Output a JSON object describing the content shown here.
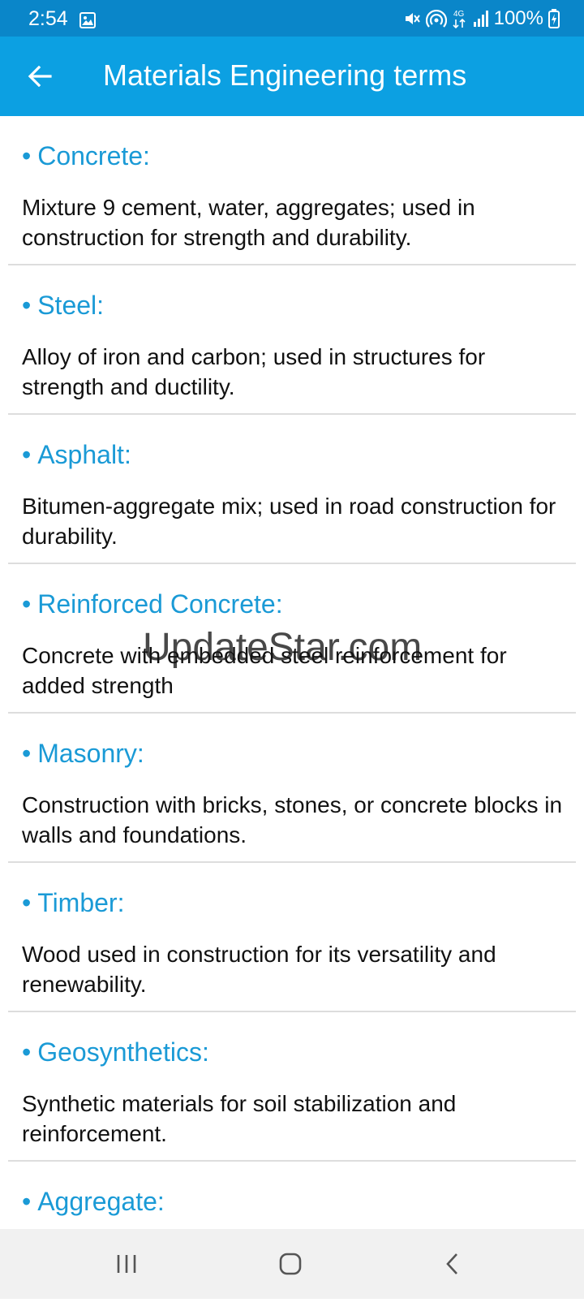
{
  "status_bar": {
    "time": "2:54",
    "network": "4G",
    "battery": "100%"
  },
  "app_bar": {
    "title": "Materials Engineering terms",
    "back_icon": "arrow-left-icon"
  },
  "terms": [
    {
      "title": "Concrete:",
      "description": "Mixture 9 cement, water, aggregates; used in construction for strength and durability."
    },
    {
      "title": "Steel:",
      "description": "Alloy of iron and carbon; used in structures for strength and ductility."
    },
    {
      "title": "Asphalt:",
      "description": "Bitumen-aggregate mix; used in road construction for durability."
    },
    {
      "title": "Reinforced Concrete:",
      "description": "Concrete with embedded steel reinforcement for added strength"
    },
    {
      "title": "Masonry:",
      "description": "Construction with bricks, stones, or concrete blocks in walls and foundations."
    },
    {
      "title": "Timber:",
      "description": "Wood used in construction for its versatility and renewability."
    },
    {
      "title": "Geosynthetics:",
      "description": "Synthetic materials for soil stabilization and reinforcement."
    },
    {
      "title": "Aggregate:",
      "description": ""
    }
  ],
  "watermark": "UpdateStar.com",
  "colors": {
    "status_bar": "#0a86c9",
    "app_bar": "#0ca0e2",
    "term_title": "#1a9ad6",
    "divider": "#dddddd",
    "nav_bar": "#f1f1f1"
  },
  "nav_icons": [
    "recent-apps-icon",
    "home-icon",
    "back-icon"
  ]
}
